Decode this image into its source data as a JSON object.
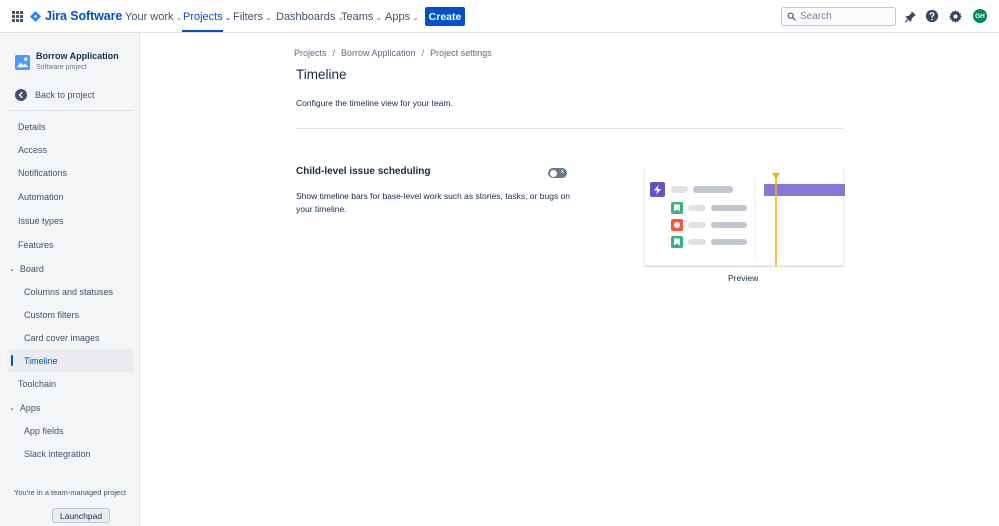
{
  "topnav": {
    "product_name": "Jira Software",
    "items": [
      {
        "label": "Your work",
        "active": false
      },
      {
        "label": "Projects",
        "active": true
      },
      {
        "label": "Filters",
        "active": false
      },
      {
        "label": "Dashboards",
        "active": false
      },
      {
        "label": "Teams",
        "active": false
      },
      {
        "label": "Apps",
        "active": false
      }
    ],
    "create_label": "Create",
    "search_placeholder": "Search",
    "avatar_initials": "GH",
    "brand_color": "#0052cc"
  },
  "sidebar": {
    "project_name": "Borrow Application",
    "project_type": "Software project",
    "back_label": "Back to project",
    "items": {
      "details": "Details",
      "access": "Access",
      "notifications": "Notifications",
      "automation": "Automation",
      "issue_types": "Issue types",
      "features": "Features",
      "board": "Board",
      "columns_statuses": "Columns and statuses",
      "custom_filters": "Custom filters",
      "card_cover_images": "Card cover images",
      "timeline": "Timeline",
      "toolchain": "Toolchain",
      "apps": "Apps",
      "app_fields": "App fields",
      "slack_integration": "Slack integration"
    },
    "active_item": "Timeline",
    "footer_text": "You're in a team-managed project",
    "launchpad_label": "Launchpad"
  },
  "main": {
    "breadcrumbs": [
      "Projects",
      "Borrow Application",
      "Project settings"
    ],
    "title": "Timeline",
    "description": "Configure the timeline view for your team.",
    "setting": {
      "title": "Child-level issue scheduling",
      "description": "Show timeline bars for base-level work such as stories, tasks, or bugs on your timeline.",
      "enabled": false
    },
    "preview_label": "Preview"
  }
}
